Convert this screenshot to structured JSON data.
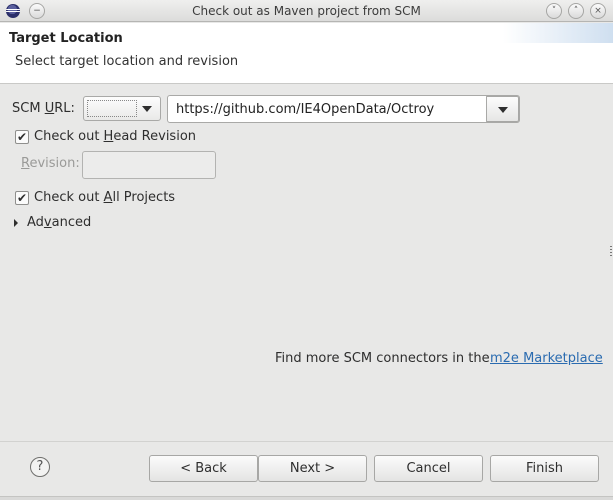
{
  "window": {
    "title": "Check out as Maven project from SCM",
    "controls": {
      "minimize": "˅",
      "maximize": "˄",
      "close": "×"
    }
  },
  "header": {
    "title": "Target Location",
    "description": "Select target location and revision"
  },
  "scm": {
    "label_pre": "SCM ",
    "label_mnemonic": "U",
    "label_post": "RL:",
    "type_value": "",
    "url_value": "https://github.com/IE4OpenData/Octroy"
  },
  "head_revision": {
    "checked": true,
    "label_pre": "Check out ",
    "label_mnemonic": "H",
    "label_post": "ead Revision"
  },
  "revision": {
    "label_mnemonic": "R",
    "label_post": "evision:",
    "value": ""
  },
  "all_projects": {
    "checked": true,
    "label_pre": "Check out ",
    "label_mnemonic": "A",
    "label_post": "ll Projects"
  },
  "advanced": {
    "label_pre": "Ad",
    "label_mnemonic": "v",
    "label_post": "anced"
  },
  "connectors": {
    "text": "Find more SCM connectors in the",
    "link": "m2e Marketplace"
  },
  "footer": {
    "help_icon": "?",
    "back": "< Back",
    "next": "Next >",
    "cancel": "Cancel",
    "finish": "Finish"
  },
  "colors": {
    "link": "#2a6bb0",
    "background": "#e8e8e7",
    "header_bg": "#ffffff"
  }
}
